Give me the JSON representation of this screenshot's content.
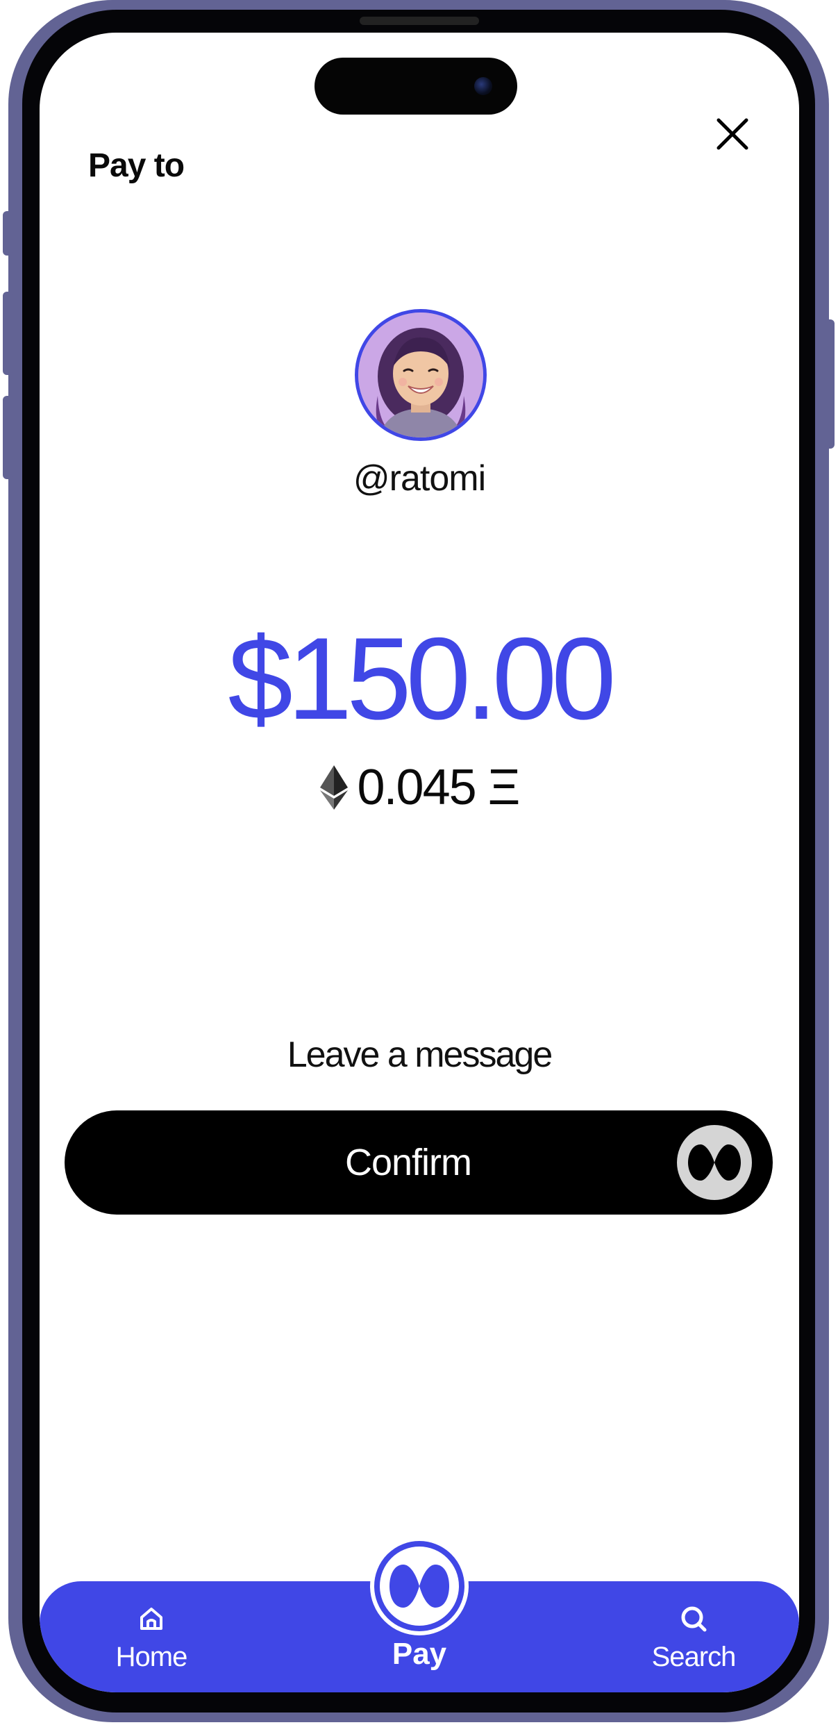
{
  "header": {
    "title": "Pay to",
    "close_icon": "close-icon"
  },
  "recipient": {
    "avatar": "avatar-photo",
    "username": "@ratomi"
  },
  "payment": {
    "amount": "$150.00",
    "crypto_amount": "0.045 Ξ",
    "crypto_icon": "ethereum-icon"
  },
  "message": {
    "label": "Leave a message"
  },
  "confirm": {
    "label": "Confirm",
    "logo_icon": "brand-logo-icon"
  },
  "nav": {
    "items": [
      {
        "label": "Home",
        "icon": "home-icon"
      },
      {
        "label": "Pay",
        "icon": "brand-logo-icon"
      },
      {
        "label": "Search",
        "icon": "search-icon"
      }
    ]
  },
  "colors": {
    "accent": "#4047E6",
    "frame": "#626394",
    "button": "#000000",
    "background": "#FFFFFF"
  }
}
